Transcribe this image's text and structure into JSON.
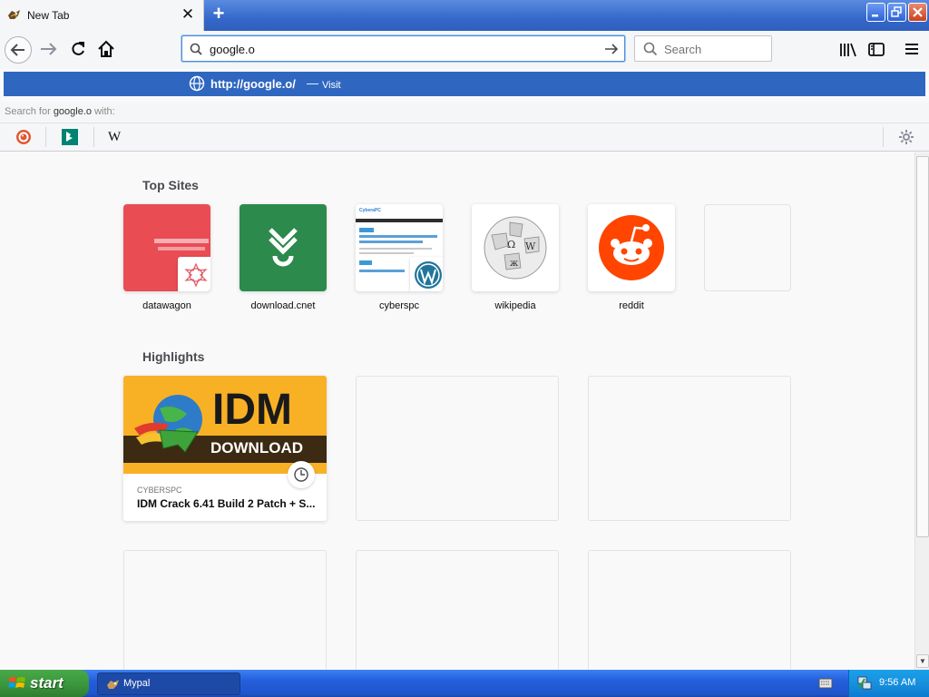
{
  "browser": {
    "tab_title": "New Tab",
    "new_tab": "+",
    "url_value": "google.o",
    "search_placeholder": "Search"
  },
  "suggestion": {
    "url": "http://google.o/",
    "separator": "—",
    "action": "Visit",
    "search_for_prefix": "Search for ",
    "search_for_term": "google.o",
    "search_for_suffix": " with:",
    "engines": [
      "duckduckgo-icon",
      "bing-icon",
      "wikipedia-icon"
    ],
    "wikipedia_glyph": "W"
  },
  "newtab": {
    "top_sites_title": "Top Sites",
    "top_sites": [
      {
        "label": "datawagon",
        "icon": "datawagon-icon"
      },
      {
        "label": "download.cnet",
        "icon": "download-cnet-icon"
      },
      {
        "label": "cyberspc",
        "icon": "cyberspc-icon"
      },
      {
        "label": "wikipedia",
        "icon": "wikipedia-globe-icon"
      },
      {
        "label": "reddit",
        "icon": "reddit-icon"
      }
    ],
    "highlights_title": "Highlights",
    "highlight": {
      "banner_big": "IDM",
      "banner_small": "DOWNLOAD",
      "source": "CYBERSPC",
      "title": "IDM Crack 6.41 Build 2 Patch + S..."
    },
    "cyberspc_thumb_title": "CyberaPC"
  },
  "taskbar": {
    "start": "start",
    "task": "Mypal",
    "clock": "9:56 AM"
  },
  "colors": {
    "accent": "#2f67c0",
    "datawagon": "#ea4c54",
    "cnet": "#2b8a4c",
    "reddit": "#ff4500",
    "idm_bg": "#f8b125"
  }
}
